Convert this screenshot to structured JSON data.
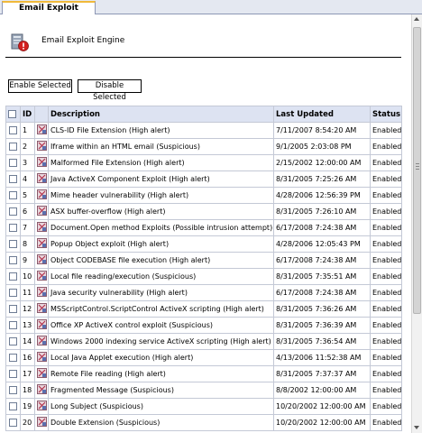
{
  "tab": {
    "label": "Email Exploit"
  },
  "header": {
    "title": "Email Exploit Engine",
    "icon": "email-exploit-engine-icon"
  },
  "toolbar": {
    "enable_label": "Enable Selected",
    "disable_label": "Disable Selected"
  },
  "table": {
    "columns": [
      "ID",
      "Description",
      "Last Updated",
      "Status"
    ],
    "rows": [
      {
        "id": "1",
        "description": "CLS-ID File Extension (High alert)",
        "updated": "7/11/2007 8:54:20 AM",
        "status": "Enabled"
      },
      {
        "id": "2",
        "description": "Iframe within an HTML email (Suspicious)",
        "updated": "9/1/2005 2:03:08 PM",
        "status": "Enabled"
      },
      {
        "id": "3",
        "description": "Malformed File Extension (High alert)",
        "updated": "2/15/2002 12:00:00 AM",
        "status": "Enabled"
      },
      {
        "id": "4",
        "description": "Java ActiveX Component Exploit (High alert)",
        "updated": "8/31/2005 7:25:26 AM",
        "status": "Enabled"
      },
      {
        "id": "5",
        "description": "Mime header vulnerability (High alert)",
        "updated": "4/28/2006 12:56:39 PM",
        "status": "Enabled"
      },
      {
        "id": "6",
        "description": "ASX buffer-overflow (High alert)",
        "updated": "8/31/2005 7:26:10 AM",
        "status": "Enabled"
      },
      {
        "id": "7",
        "description": "Document.Open method Exploits (Possible intrusion attempt)",
        "updated": "6/17/2008 7:24:38 AM",
        "status": "Enabled"
      },
      {
        "id": "8",
        "description": "Popup Object exploit (High alert)",
        "updated": "4/28/2006 12:05:43 PM",
        "status": "Enabled"
      },
      {
        "id": "9",
        "description": "Object CODEBASE file execution (High alert)",
        "updated": "6/17/2008 7:24:38 AM",
        "status": "Enabled"
      },
      {
        "id": "10",
        "description": "Local file reading/execution (Suspicious)",
        "updated": "8/31/2005 7:35:51 AM",
        "status": "Enabled"
      },
      {
        "id": "11",
        "description": "Java security vulnerability (High alert)",
        "updated": "6/17/2008 7:24:38 AM",
        "status": "Enabled"
      },
      {
        "id": "12",
        "description": "MSScriptControl.ScriptControl ActiveX scripting (High alert)",
        "updated": "8/31/2005 7:36:26 AM",
        "status": "Enabled"
      },
      {
        "id": "13",
        "description": "Office XP ActiveX control exploit (Suspicious)",
        "updated": "8/31/2005 7:36:39 AM",
        "status": "Enabled"
      },
      {
        "id": "14",
        "description": "Windows 2000 indexing service ActiveX scripting (High alert)",
        "updated": "8/31/2005 7:36:54 AM",
        "status": "Enabled"
      },
      {
        "id": "16",
        "description": "Local Java Applet execution (High alert)",
        "updated": "4/13/2006 11:52:38 AM",
        "status": "Enabled"
      },
      {
        "id": "17",
        "description": "Remote File reading (High alert)",
        "updated": "8/31/2005 7:37:37 AM",
        "status": "Enabled"
      },
      {
        "id": "18",
        "description": "Fragmented Message (Suspicious)",
        "updated": "8/8/2002 12:00:00 AM",
        "status": "Enabled"
      },
      {
        "id": "19",
        "description": "Long Subject (Suspicious)",
        "updated": "10/20/2002 12:00:00 AM",
        "status": "Enabled"
      },
      {
        "id": "20",
        "description": "Double Extension (Suspicious)",
        "updated": "10/20/2002 12:00:00 AM",
        "status": "Enabled"
      }
    ]
  },
  "colors": {
    "header_bg": "#dde3f2",
    "tab_accent": "#f0b93a",
    "grid_border": "#c4c9d6"
  }
}
